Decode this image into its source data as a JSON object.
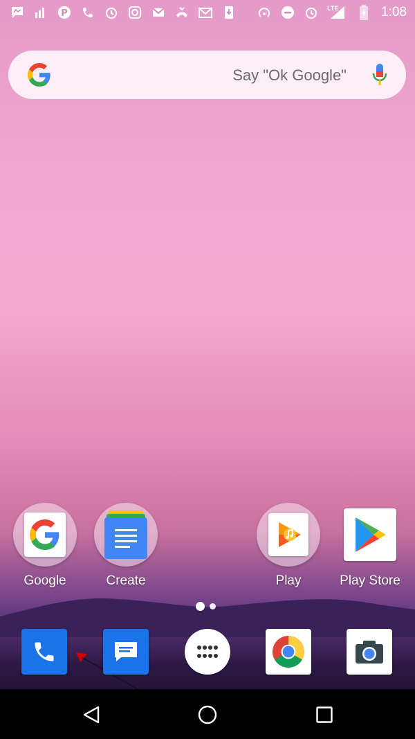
{
  "status_bar": {
    "time": "1:08",
    "network": "LTE",
    "left_icons": [
      "messenger-icon",
      "mobile-data-icon",
      "pinterest-icon",
      "missed-call-icon",
      "alarm-icon",
      "instagram-icon",
      "gmail-icon",
      "call-forward-icon",
      "email-icon",
      "download-icon"
    ],
    "right_icons": [
      "hotspot-icon",
      "do-not-disturb-icon",
      "alarm-icon",
      "signal-icon",
      "battery-icon"
    ]
  },
  "search": {
    "hint": "Say \"Ok Google\""
  },
  "home_apps": [
    {
      "label": "Google",
      "icon": "google-folder-icon"
    },
    {
      "label": "Create",
      "icon": "docs-folder-icon"
    },
    {
      "label": "Play",
      "icon": "play-music-folder-icon"
    },
    {
      "label": "Play Store",
      "icon": "play-store-icon"
    }
  ],
  "dock": [
    {
      "name": "phone",
      "icon": "phone-icon",
      "color": "#1a73e8"
    },
    {
      "name": "messages",
      "icon": "messages-icon",
      "color": "#1a73e8"
    },
    {
      "name": "app-drawer",
      "icon": "apps-grid-icon",
      "color": "#ffffff"
    },
    {
      "name": "chrome",
      "icon": "chrome-icon",
      "color": "#ffffff"
    },
    {
      "name": "camera",
      "icon": "camera-icon",
      "color": "#ffffff"
    }
  ],
  "navigation": [
    "back-icon",
    "home-icon",
    "recents-icon"
  ]
}
